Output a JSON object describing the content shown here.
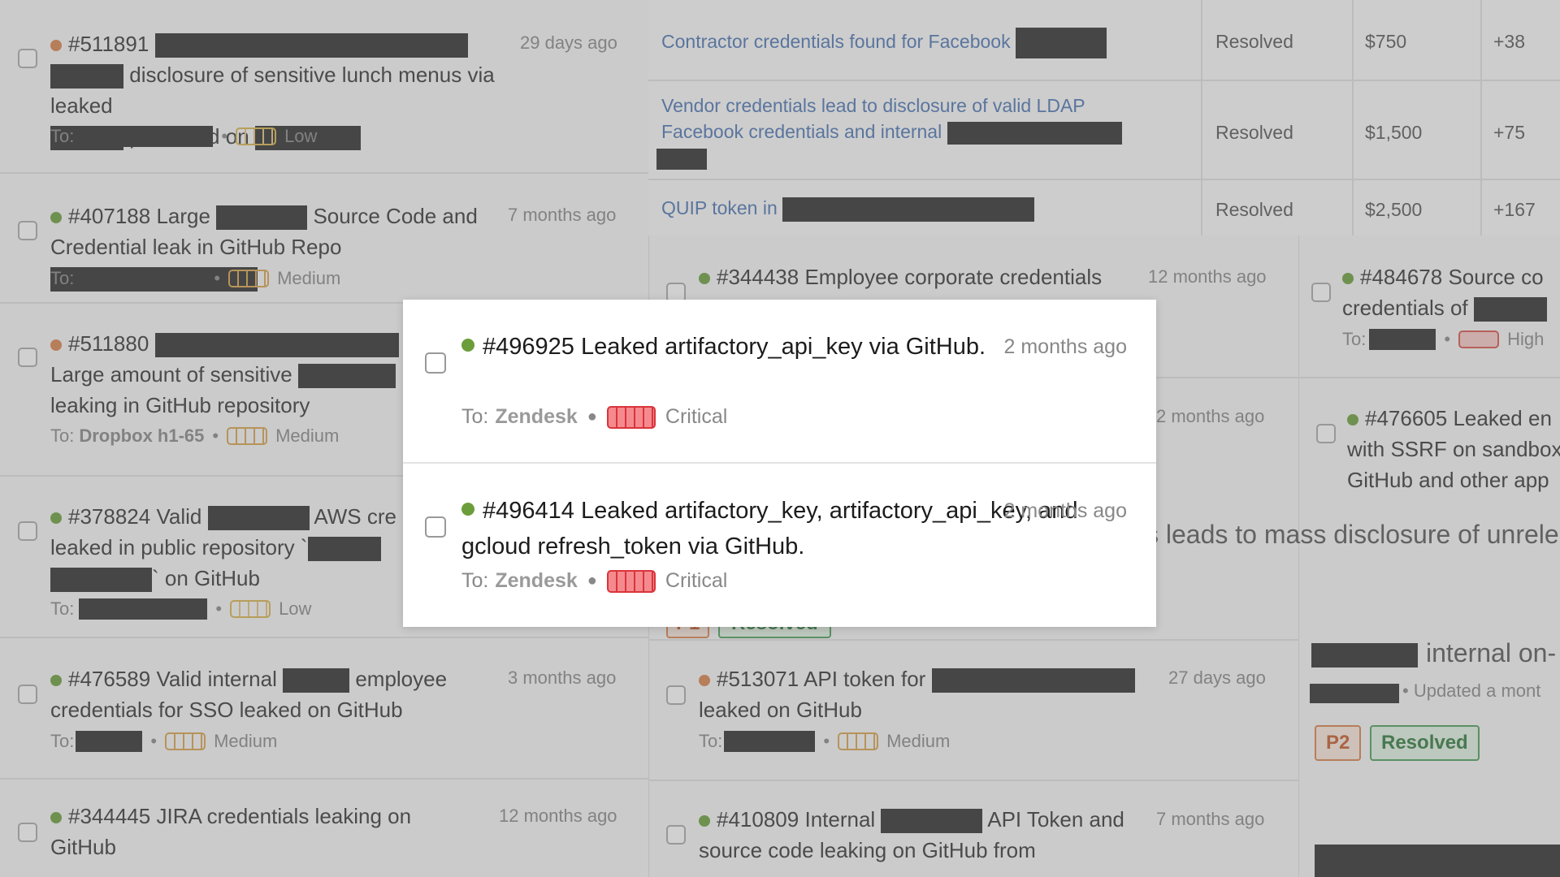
{
  "background": {
    "left_reports": [
      {
        "id": "#511891",
        "title_part1": "",
        "title_part2": "disclosure of sensitive lunch menus via leaked",
        "title_part3": "password on",
        "time": "29 days ago",
        "to_label": "To:",
        "severity": "Low",
        "status_dot": "orange"
      },
      {
        "id": "#407188",
        "title_part1": "Large",
        "title_part2": "Source Code and",
        "title_part3": "Credential leak in GitHub Repo",
        "time": "7 months ago",
        "to_label": "To:",
        "severity": "Medium",
        "status_dot": "green"
      },
      {
        "id": "#511880",
        "title_part1": "",
        "title_part2": "Large amount of sensitive",
        "title_part3": "leaking in GitHub repository",
        "time": "",
        "to_label": "To:",
        "team": "Dropbox h1-65",
        "severity": "Medium",
        "status_dot": "orange"
      },
      {
        "id": "#378824",
        "title_part1": "Valid",
        "title_part2": "AWS cre",
        "title_part3": "leaked in public repository `",
        "title_part4": "` on GitHub",
        "time": "",
        "to_label": "To:",
        "severity": "Low",
        "status_dot": "green"
      },
      {
        "id": "#476589",
        "title_part1": "Valid internal",
        "title_part2": "employee",
        "title_part3": "credentials for SSO leaked on GitHub",
        "time": "3 months ago",
        "to_label": "To:",
        "severity": "Medium",
        "status_dot": "green"
      },
      {
        "id": "#344445",
        "title_part1": "JIRA credentials leaking on",
        "title_part2": "GitHub",
        "time": "12 months ago",
        "status_dot": "green"
      }
    ],
    "table_rows": [
      {
        "title": "Contractor credentials found for Facebook",
        "status": "Resolved",
        "bounty": "$750",
        "points": "+38"
      },
      {
        "title_line1": "Vendor credentials lead to disclosure of valid LDAP",
        "title_line2": "Facebook credentials and internal",
        "status": "Resolved",
        "bounty": "$1,500",
        "points": "+75"
      },
      {
        "title": "QUIP token in",
        "status": "Resolved",
        "bounty": "$2,500",
        "points": "+167"
      }
    ],
    "mid_reports": [
      {
        "id": "#344438",
        "title": "Employee corporate credentials",
        "time": "12 months ago",
        "status_dot": "green"
      },
      {
        "time": "2 months ago"
      },
      {
        "id": "#513071",
        "title_part1": "API token for",
        "title_part2": "leaked on GitHub",
        "time": "27 days ago",
        "to_label": "To:",
        "severity": "Medium",
        "status_dot": "orange"
      },
      {
        "id": "#410809",
        "title_part1": "Internal",
        "title_part2": "API Token and",
        "title_part3": "source code leaking on GitHub from",
        "time": "7 months ago",
        "status_dot": "green"
      }
    ],
    "right_reports": [
      {
        "id": "#484678",
        "title_part1": "Source co",
        "title_part2": "credentials of",
        "to_label": "To:",
        "severity": "High",
        "status_dot": "green"
      },
      {
        "id": "#476605",
        "title_part1": "Leaked en",
        "title_part2": "with SSRF on sandbox",
        "title_part3": "GitHub and other app",
        "status_dot": "green"
      }
    ],
    "big_text": "s leads to mass disclosure of unrele",
    "right_snippet": "internal on-",
    "right_updated": "• Updated a mont",
    "badge_priority": "P2",
    "badge_status": "Resolved",
    "badge_p1": "P1",
    "badge_resolved_mid": "Resolved"
  },
  "popup": {
    "items": [
      {
        "id": "#496925",
        "title": "Leaked artifactory_api_key via GitHub.",
        "time": "2 months ago",
        "to_label": "To:",
        "team": "Zendesk",
        "severity": "Critical",
        "status_dot": "green"
      },
      {
        "id": "#496414",
        "title": "Leaked artifactory_key, artifactory_api_key, and gcloud refresh_token via GitHub.",
        "time": "2 months ago",
        "to_label": "To:",
        "team": "Zendesk",
        "severity": "Critical",
        "status_dot": "green"
      }
    ]
  }
}
